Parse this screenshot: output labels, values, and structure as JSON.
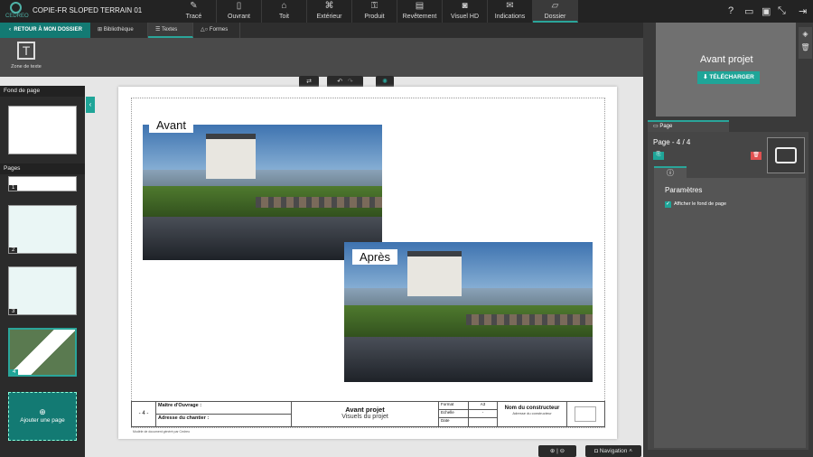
{
  "app": {
    "logo_text": "CEDREO",
    "project_title": "COPIE-FR SLOPED TERRAIN 01"
  },
  "main_tabs": [
    {
      "label": "Tracé",
      "icon": "pencil-icon"
    },
    {
      "label": "Ouvrant",
      "icon": "door-icon"
    },
    {
      "label": "Toit",
      "icon": "roof-icon"
    },
    {
      "label": "Extérieur",
      "icon": "exterior-icon"
    },
    {
      "label": "Produit",
      "icon": "product-icon"
    },
    {
      "label": "Revêtement",
      "icon": "paint-roller-icon"
    },
    {
      "label": "Visuel HD",
      "icon": "camera-icon"
    },
    {
      "label": "Indications",
      "icon": "indications-icon"
    },
    {
      "label": "Dossier",
      "icon": "folder-icon",
      "active": true
    }
  ],
  "sub": {
    "back": "RETOUR À MON DOSSIER",
    "tabs": [
      {
        "label": "Bibliothèque"
      },
      {
        "label": "Textes",
        "active": true
      },
      {
        "label": "Formes"
      }
    ]
  },
  "tools": {
    "text_zone": "Zone de texte"
  },
  "left": {
    "background_header": "Fond de page",
    "pages_header": "Pages",
    "pages": [
      "1",
      "2",
      "3",
      "4"
    ],
    "selected_page": "4",
    "add_page": "Ajouter une page"
  },
  "page": {
    "label_before": "Avant",
    "label_after": "Après",
    "footer_note": "Modèle de document généré par Cedreo",
    "title_block": {
      "page_num": "- 4 -",
      "owner": "Maître d'Ouvrage :",
      "site": "Adresse du chantier :",
      "title": "Avant projet",
      "subtitle": "Visuels du projet",
      "format_label": "Format",
      "format_value": "A3",
      "scale_label": "Echelle",
      "scale_value": "-",
      "date_label": "Date",
      "builder_name": "Nom du constructeur",
      "builder_address": "Adresse du constructeur"
    }
  },
  "bottom": {
    "navigation": "Navigation"
  },
  "right": {
    "preview_title": "Avant projet",
    "download": "TÉLÉCHARGER",
    "panel_tab": "Page",
    "page_indicator": "Page - 4 / 4",
    "params_title": "Paramètres",
    "show_background": "Afficher le fond de page",
    "show_background_checked": true
  },
  "colors": {
    "accent": "#1fa598",
    "delete": "#e05050"
  }
}
